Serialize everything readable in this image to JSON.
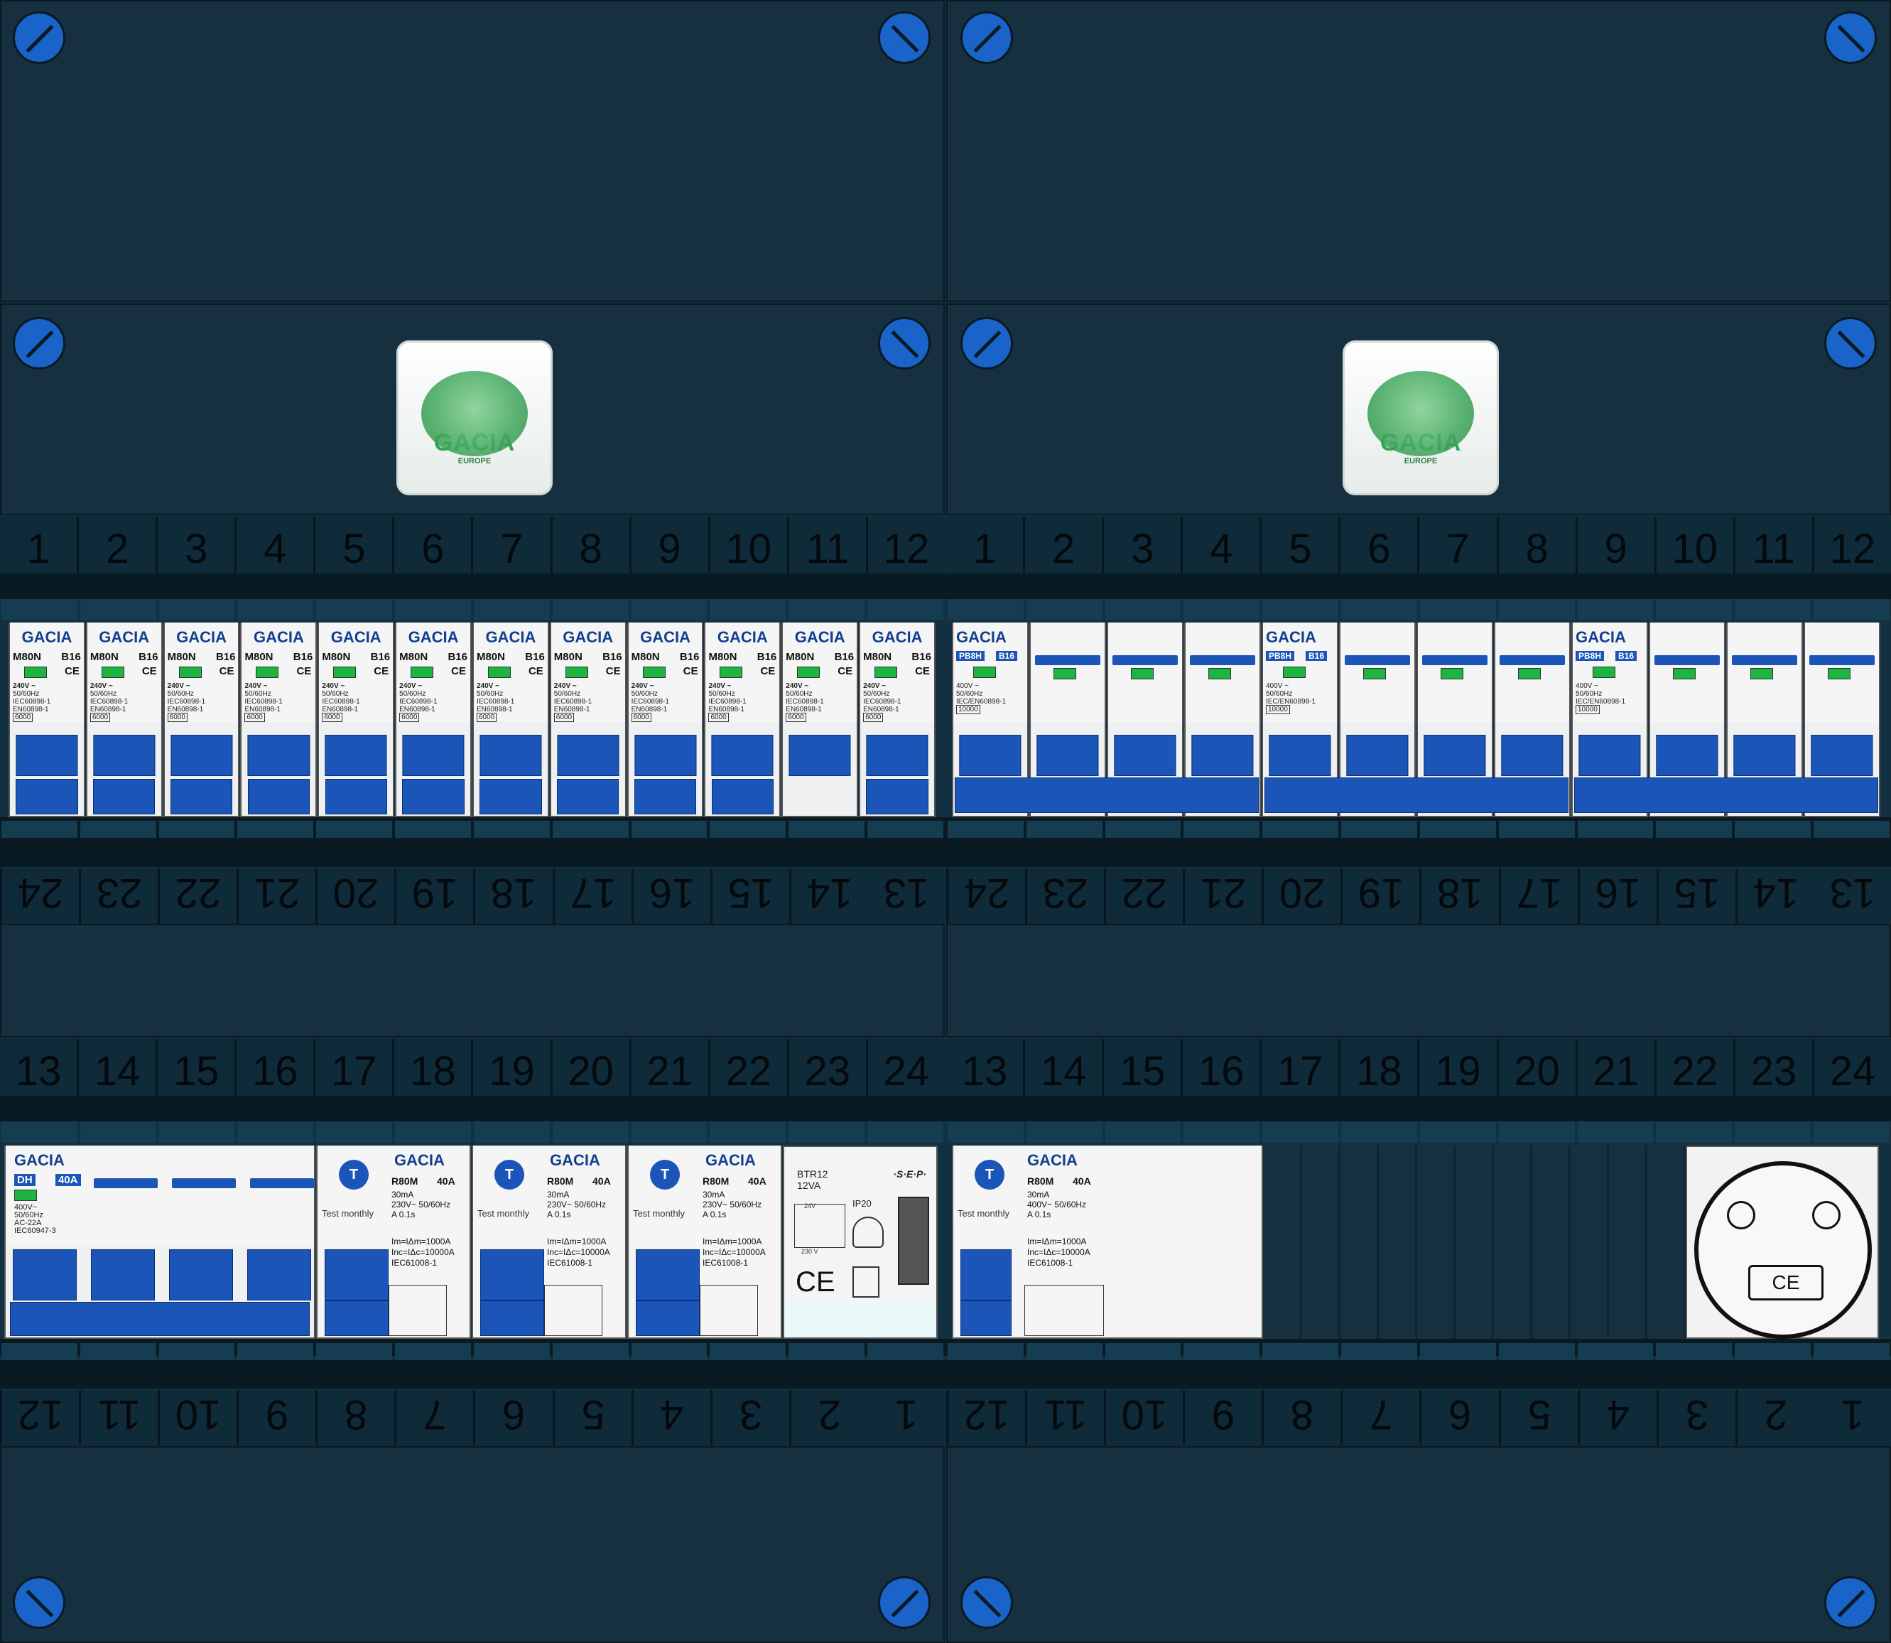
{
  "brand": "GACIA",
  "logo": {
    "name": "GACIA",
    "sub": "EUROPE"
  },
  "colors": {
    "panel": "#16303f",
    "breaker_blue": "#1c55b8",
    "indicator_green": "#1db542",
    "screw_blue": "#1a63c9",
    "brand_blue": "#123f8f"
  },
  "top_numbers": [
    "1",
    "2",
    "3",
    "4",
    "5",
    "6",
    "7",
    "8",
    "9",
    "10",
    "11",
    "12"
  ],
  "mid_numbers": [
    "24",
    "23",
    "22",
    "21",
    "20",
    "19",
    "18",
    "17",
    "16",
    "15",
    "14",
    "13"
  ],
  "lower_numbers": [
    "13",
    "14",
    "15",
    "16",
    "17",
    "18",
    "19",
    "20",
    "21",
    "22",
    "23",
    "24"
  ],
  "bottom_numbers": [
    "12",
    "11",
    "10",
    "9",
    "8",
    "7",
    "6",
    "5",
    "4",
    "3",
    "2",
    "1"
  ],
  "mcb": {
    "model": "M80N",
    "rating": "B16",
    "volt": "240V ~",
    "freq": "50/60Hz",
    "std1": "IEC60898-1",
    "std2": "EN60898-1",
    "cap": "6000"
  },
  "pb8h": {
    "model": "PB8H",
    "rating": "B16",
    "volt": "400V ~",
    "freq": "50/60Hz",
    "std": "IEC/EN60898-1",
    "cap": "10000"
  },
  "dh": {
    "model": "DH",
    "rating": "40A",
    "volt": "400V~",
    "freq": "50/60Hz",
    "type": "AC-22A",
    "std": "IEC60947-3"
  },
  "rcd": {
    "t": "T",
    "test": "Test monthly",
    "model": "R80M",
    "rating": "40A",
    "sens": "30mA",
    "volt_a": "230V~",
    "volt_b": "400V~",
    "freq": "50/60Hz",
    "type": "A",
    "time": "0.1s",
    "im": "Im=IΔm=1000A",
    "inc": "Inc=IΔc=10000A",
    "std": "IEC61008-1"
  },
  "trafo": {
    "model": "BTR12",
    "va": "12VA",
    "brand": "·S·E·P·",
    "ip": "IP20",
    "v24": "24V",
    "v230": "230 V",
    "ce": "CE"
  },
  "socket": {
    "ce": "CE"
  }
}
